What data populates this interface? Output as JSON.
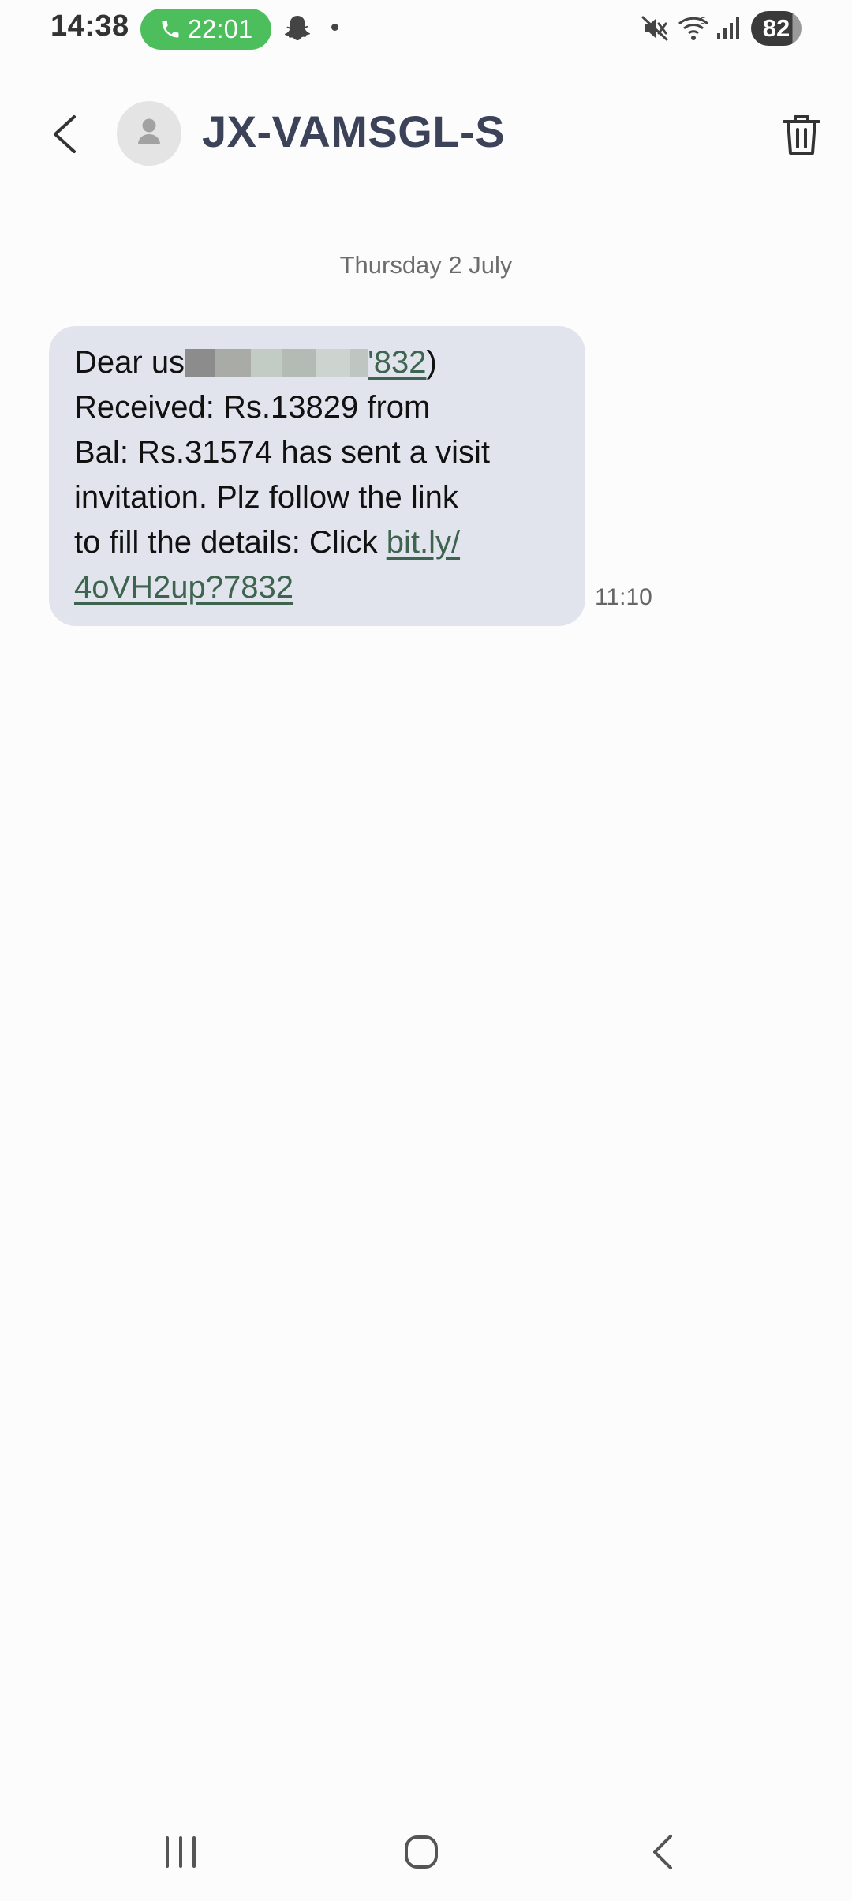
{
  "status_bar": {
    "time": "14:38",
    "call_duration": "22:01",
    "battery": "82"
  },
  "header": {
    "contact_name": "JX-VAMSGL-S"
  },
  "conversation": {
    "date_separator": "Thursday 2 July",
    "message": {
      "line1_prefix": "Dear us",
      "line1_link_tail": "'832",
      "line1_suffix": ")",
      "line2": "Received: Rs.13829 from",
      "line3": "Bal: Rs.31574 has sent a visit",
      "line4": "invitation. Plz follow the link",
      "line5_text": "to fill the details: Click ",
      "line5_link": "bit.ly/",
      "line6_link": "4oVH2up?7832",
      "time": "11:10"
    }
  },
  "colors": {
    "bubble_bg": "#e2e4ed",
    "link": "#3e6450",
    "title": "#3c4359",
    "call_pill": "#4cbf5c"
  },
  "icons": {
    "back": "chevron-left-icon",
    "avatar": "person-icon",
    "delete": "trash-icon",
    "call": "phone-icon",
    "notification": "snapchat-ghost-icon",
    "mute": "mute-icon",
    "wifi": "wifi-icon",
    "signal": "signal-icon"
  }
}
